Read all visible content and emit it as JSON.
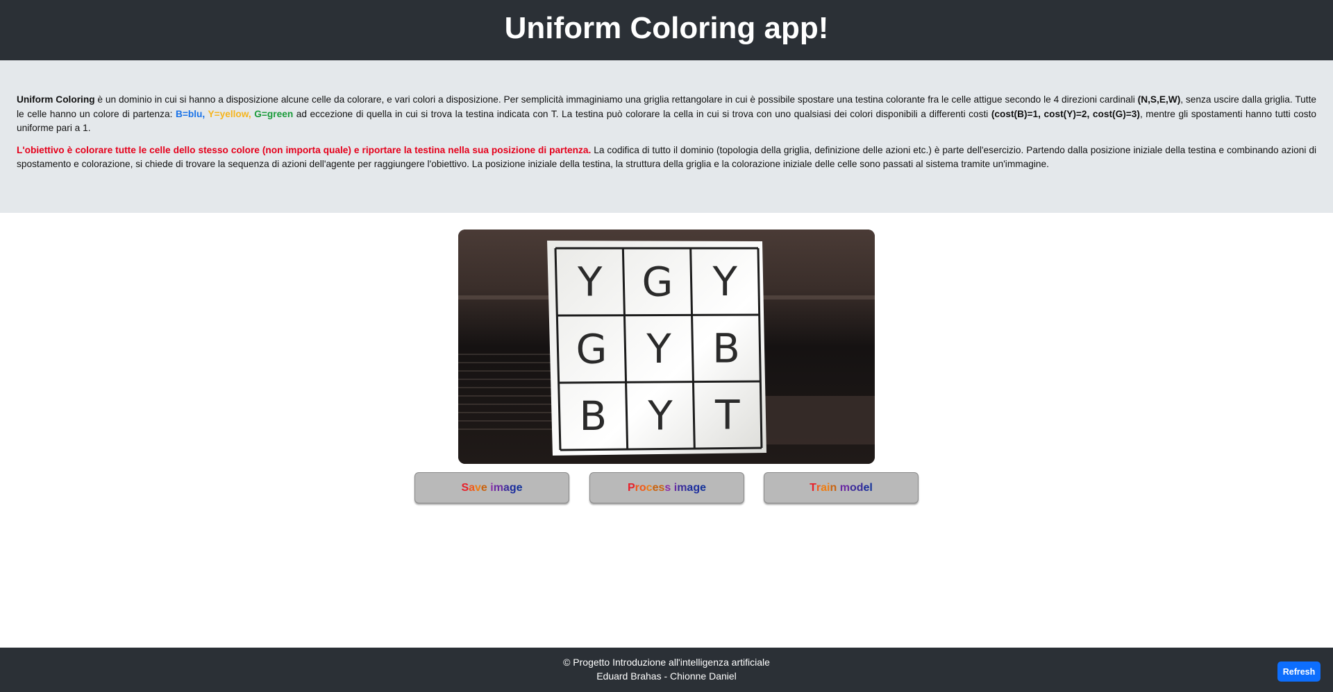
{
  "header": {
    "title": "Uniform Coloring app!"
  },
  "intro": {
    "p1": {
      "lead": "Uniform Coloring",
      "t1": " è un dominio in cui si hanno a disposizione alcune celle da colorare, e vari colori a disposizione. Per semplicità immaginiamo una griglia rettangolare in cui è possibile spostare una testina colorante fra le celle attigue secondo le 4 direzioni cardinali ",
      "dirs": "(N,S,E,W)",
      "t2": ", senza uscire dalla griglia. Tutte le celle hanno un colore di partenza: ",
      "blue": "B=blu,",
      "yellow": " Y=yellow,",
      "green": " G=green",
      "t3": " ad eccezione di quella in cui si trova la testina indicata con T. La testina può colorare la cella in cui si trova con uno qualsiasi dei colori disponibili a differenti costi ",
      "costs": "(cost(B)=1, cost(Y)=2, cost(G)=3)",
      "t4": ", mentre gli spostamenti hanno tutti costo uniforme pari a 1."
    },
    "p2": {
      "goal": "L'obiettivo è colorare tutte le celle dello stesso colore (non importa quale) e riportare la testina nella sua posizione di partenza.",
      "t1": " La codifica di tutto il dominio (topologia della griglia, definizione delle azioni etc.) è parte dell'esercizio. Partendo dalla posizione iniziale della testina e combinando azioni di spostamento e colorazione, si chiede di trovare la sequenza di azioni dell'agente per raggiungere l'obiettivo. La posizione iniziale della testina, la struttura della griglia e la colorazione iniziale delle celle sono passati al sistema tramite un'immagine."
    }
  },
  "grid": {
    "rows": [
      [
        "Y",
        "G",
        "Y"
      ],
      [
        "G",
        "Y",
        "B"
      ],
      [
        "B",
        "Y",
        "T"
      ]
    ]
  },
  "buttons": {
    "save": "Save image",
    "process": "Process image",
    "train": "Train model"
  },
  "rainbow": [
    "#e8202a",
    "#f05a1a",
    "#ef7d12",
    "#c9630f",
    "#8a2fa8",
    "#6a2aa3",
    "#3b2d9a",
    "#1d2e9e",
    "#15339a"
  ],
  "footer": {
    "line1": "© Progetto Introduzione all'intelligenza artificiale",
    "line2": "Eduard Brahas - Chionne Daniel",
    "refresh": "Refresh"
  }
}
